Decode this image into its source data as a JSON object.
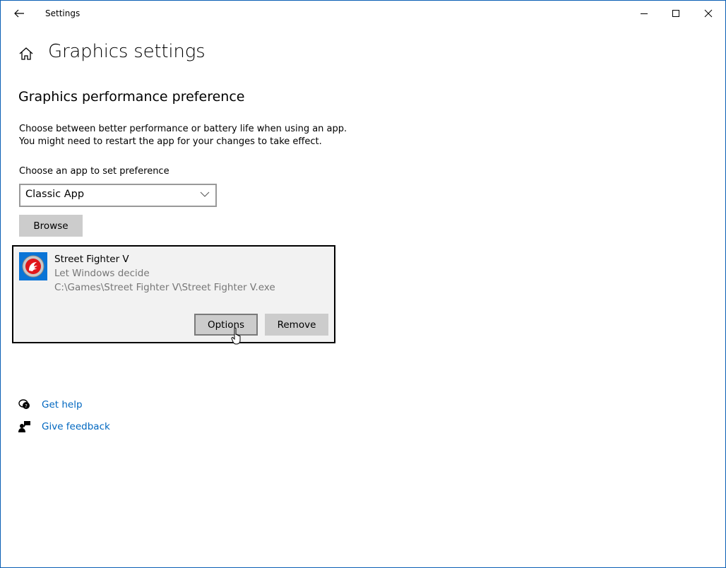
{
  "window": {
    "title": "Settings",
    "controls": {
      "minimize": "minimize-icon",
      "maximize": "maximize-icon",
      "close": "close-icon"
    },
    "accent_color": "#0a5fb4"
  },
  "page": {
    "title": "Graphics settings",
    "section_title": "Graphics performance preference",
    "description_line1": "Choose between better performance or battery life when using an app.",
    "description_line2": "You might need to restart the app for your changes to take effect.",
    "choose_label": "Choose an app to set preference",
    "app_type_selected": "Classic App",
    "browse_label": "Browse"
  },
  "app_entry": {
    "name": "Street Fighter V",
    "preference": "Let Windows decide",
    "path": "C:\\Games\\Street Fighter V\\Street Fighter V.exe",
    "options_label": "Options",
    "remove_label": "Remove"
  },
  "links": [
    {
      "icon": "help-chat-icon",
      "label": "Get help"
    },
    {
      "icon": "feedback-icon",
      "label": "Give feedback"
    }
  ],
  "colors": {
    "link": "#0067c0",
    "button": "#cccccc",
    "card_bg": "#f2f2f2",
    "app_icon_bg": "#0a74d6"
  }
}
